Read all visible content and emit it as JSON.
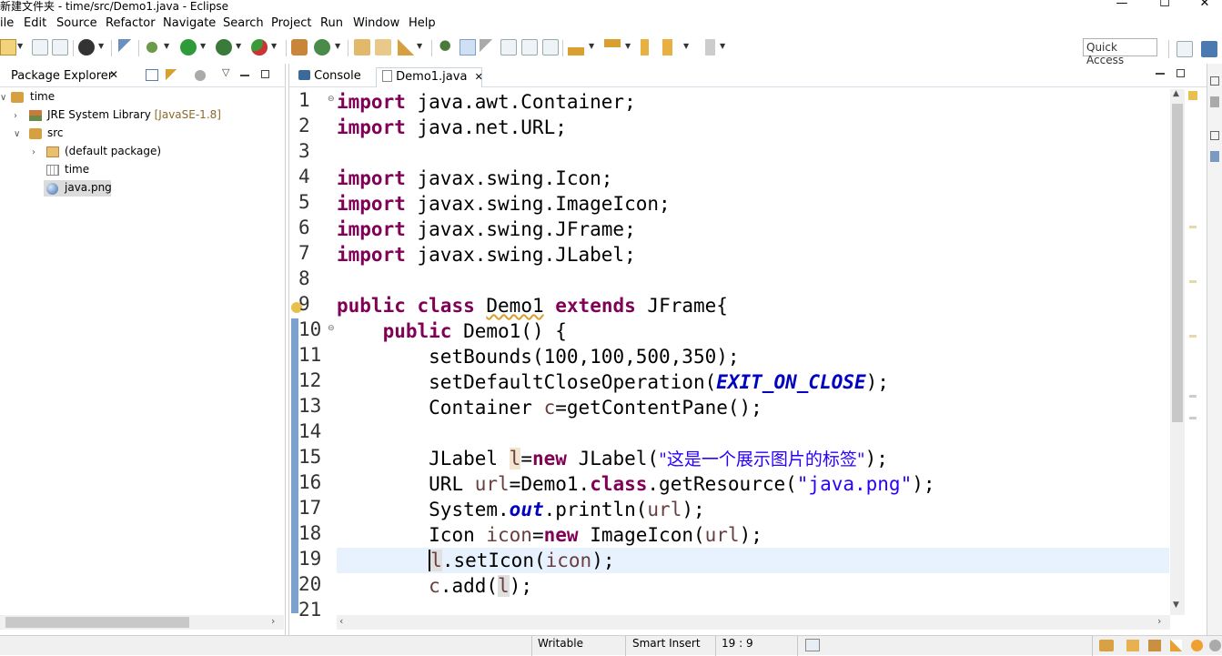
{
  "window": {
    "title": "新建文件夹 - time/src/Demo1.java - Eclipse",
    "minimize": "—",
    "maximize": "☐",
    "close": "✕"
  },
  "menu": [
    "ile",
    "Edit",
    "Source",
    "Refactor",
    "Navigate",
    "Search",
    "Project",
    "Run",
    "Window",
    "Help"
  ],
  "toolbar": {
    "quick_access_placeholder": "Quick Access"
  },
  "package_explorer": {
    "title": "Package Explorer",
    "close": "✕",
    "tree": {
      "project": "time",
      "jre_label": "JRE System Library",
      "jre_version": "[JavaSE-1.8]",
      "src": "src",
      "default_package": "(default package)",
      "time_package": "time",
      "file": "java.png"
    }
  },
  "editor": {
    "tabs": [
      {
        "label": "Console",
        "active": false
      },
      {
        "label": "Demo1.java",
        "active": true
      }
    ],
    "tab_close": "✕",
    "line_numbers": [
      "1",
      "2",
      "3",
      "4",
      "5",
      "6",
      "7",
      "8",
      "9",
      "10",
      "11",
      "12",
      "13",
      "14",
      "15",
      "16",
      "17",
      "18",
      "19",
      "20",
      "21"
    ],
    "code": {
      "l1_kw": "import",
      "l1_rest": " java.awt.Container;",
      "l2_kw": "import",
      "l2_rest": " java.net.URL;",
      "l4_kw": "import",
      "l4_rest": " javax.swing.Icon;",
      "l5_kw": "import",
      "l5_rest": " javax.swing.ImageIcon;",
      "l6_kw": "import",
      "l6_rest": " javax.swing.JFrame;",
      "l7_kw": "import",
      "l7_rest": " javax.swing.JLabel;",
      "l9_kw1": "public",
      "l9_kw2": "class",
      "l9_name": "Demo1",
      "l9_kw3": "extends",
      "l9_rest": " JFrame{",
      "l10_kw": "public",
      "l10_rest": " Demo1() {",
      "l11": "setBounds(100,100,500,350);",
      "l12_a": "setDefaultCloseOperation(",
      "l12_field": "EXIT_ON_CLOSE",
      "l12_b": ");",
      "l13_a": "Container ",
      "l13_var": "c",
      "l13_b": "=getContentPane();",
      "l15_a": "JLabel ",
      "l15_var": "l",
      "l15_b": "=",
      "l15_kw": "new",
      "l15_c": " JLabel(",
      "l15_str": "\"这是一个展示图片的标签\"",
      "l15_d": ");",
      "l16_a": "URL ",
      "l16_var": "url",
      "l16_b": "=Demo1.",
      "l16_kw": "class",
      "l16_c": ".getResource(",
      "l16_str": "\"java.png\"",
      "l16_d": ");",
      "l17_a": "System.",
      "l17_field": "out",
      "l17_b": ".println(",
      "l17_var": "url",
      "l17_c": ");",
      "l18_a": "Icon ",
      "l18_var": "icon",
      "l18_b": "=",
      "l18_kw": "new",
      "l18_c": " ImageIcon(",
      "l18_var2": "url",
      "l18_d": ");",
      "l19_var": "l",
      "l19_a": ".setIcon(",
      "l19_var2": "icon",
      "l19_b": ");",
      "l20_var": "c",
      "l20_a": ".add(",
      "l20_var2": "l",
      "l20_b": ");"
    }
  },
  "status": {
    "writable": "Writable",
    "insert_mode": "Smart Insert",
    "position": "19 : 9"
  },
  "colors": {
    "keyword": "#7f0055",
    "string": "#2a00ff",
    "field": "#0000c0",
    "local_var": "#6a3e3e",
    "current_line": "#e8f2fe"
  }
}
